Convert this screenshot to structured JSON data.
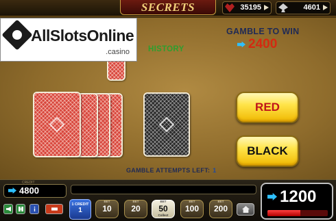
{
  "header": {
    "title": "SECRETS",
    "meter_left": {
      "icon": "heart-icon",
      "value": "35195"
    },
    "meter_right": {
      "icon": "spade-icon",
      "value": "4601"
    }
  },
  "logo": {
    "main": "AllSlotsOnline",
    "sub": ".casino"
  },
  "gamble": {
    "previous_win": "1200",
    "history_label": "HISTORY",
    "title": "GAMBLE TO WIN",
    "amount": "2400",
    "red_label": "RED",
    "black_label": "BLACK",
    "attempts_label": "GAMBLE ATTEMPTS LEFT:",
    "attempts_value": "1",
    "colors": {
      "red_card": "#d8463c",
      "black_card": "#2a2a2a",
      "button": "#ffe44a"
    }
  },
  "bottom": {
    "credit_caption": "CREDIT",
    "credit": "4800",
    "controls": [
      "sound-icon",
      "fullscreen-icon",
      "info-icon",
      "exit-icon"
    ],
    "line_caption": "1 CREDIT",
    "line_value": "1",
    "bets": [
      {
        "caption": "BET",
        "value": "10"
      },
      {
        "caption": "BET",
        "value": "20"
      },
      {
        "caption": "BET",
        "value": "50",
        "sub": "Collect"
      },
      {
        "caption": "BET",
        "value": "100"
      },
      {
        "caption": "BET",
        "value": "200"
      }
    ],
    "win": "1200",
    "win_bar_level": 0.55
  }
}
